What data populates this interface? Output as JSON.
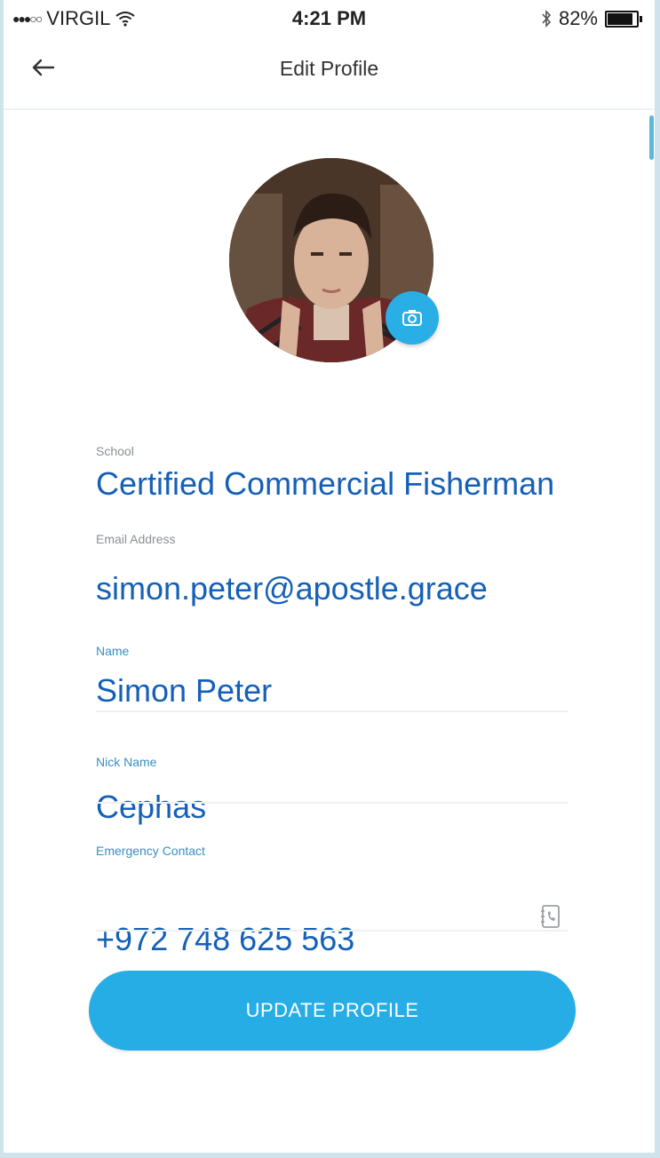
{
  "status_bar": {
    "carrier": "VIRGIL",
    "time": "4:21 PM",
    "battery": "82%",
    "battery_level": 0.82,
    "icons": [
      "signal-dots-icon",
      "wifi-icon",
      "bluetooth-icon",
      "battery-icon"
    ]
  },
  "nav": {
    "title": "Edit Profile",
    "back_icon": "arrow-left-icon"
  },
  "profile": {
    "camera_icon": "camera-icon"
  },
  "fields": {
    "school": {
      "label": "School",
      "value": "Certified Commercial Fisherman"
    },
    "email": {
      "label": "Email Address",
      "value": "simon.peter@apostle.grace"
    },
    "name": {
      "label": "Name",
      "value": "Simon Peter"
    },
    "nickname": {
      "label": "Nick Name",
      "value": "Cephas"
    },
    "emergency": {
      "label": "Emergency Contact",
      "value": "+972 748 625 563",
      "icon": "phone-book-icon"
    }
  },
  "update_button": {
    "label": "UPDATE PROFILE"
  },
  "colors": {
    "accent": "#27ade6",
    "value_text": "#1560b7",
    "label_text": "#8a8f94",
    "label_blue": "#3a8fc4"
  }
}
